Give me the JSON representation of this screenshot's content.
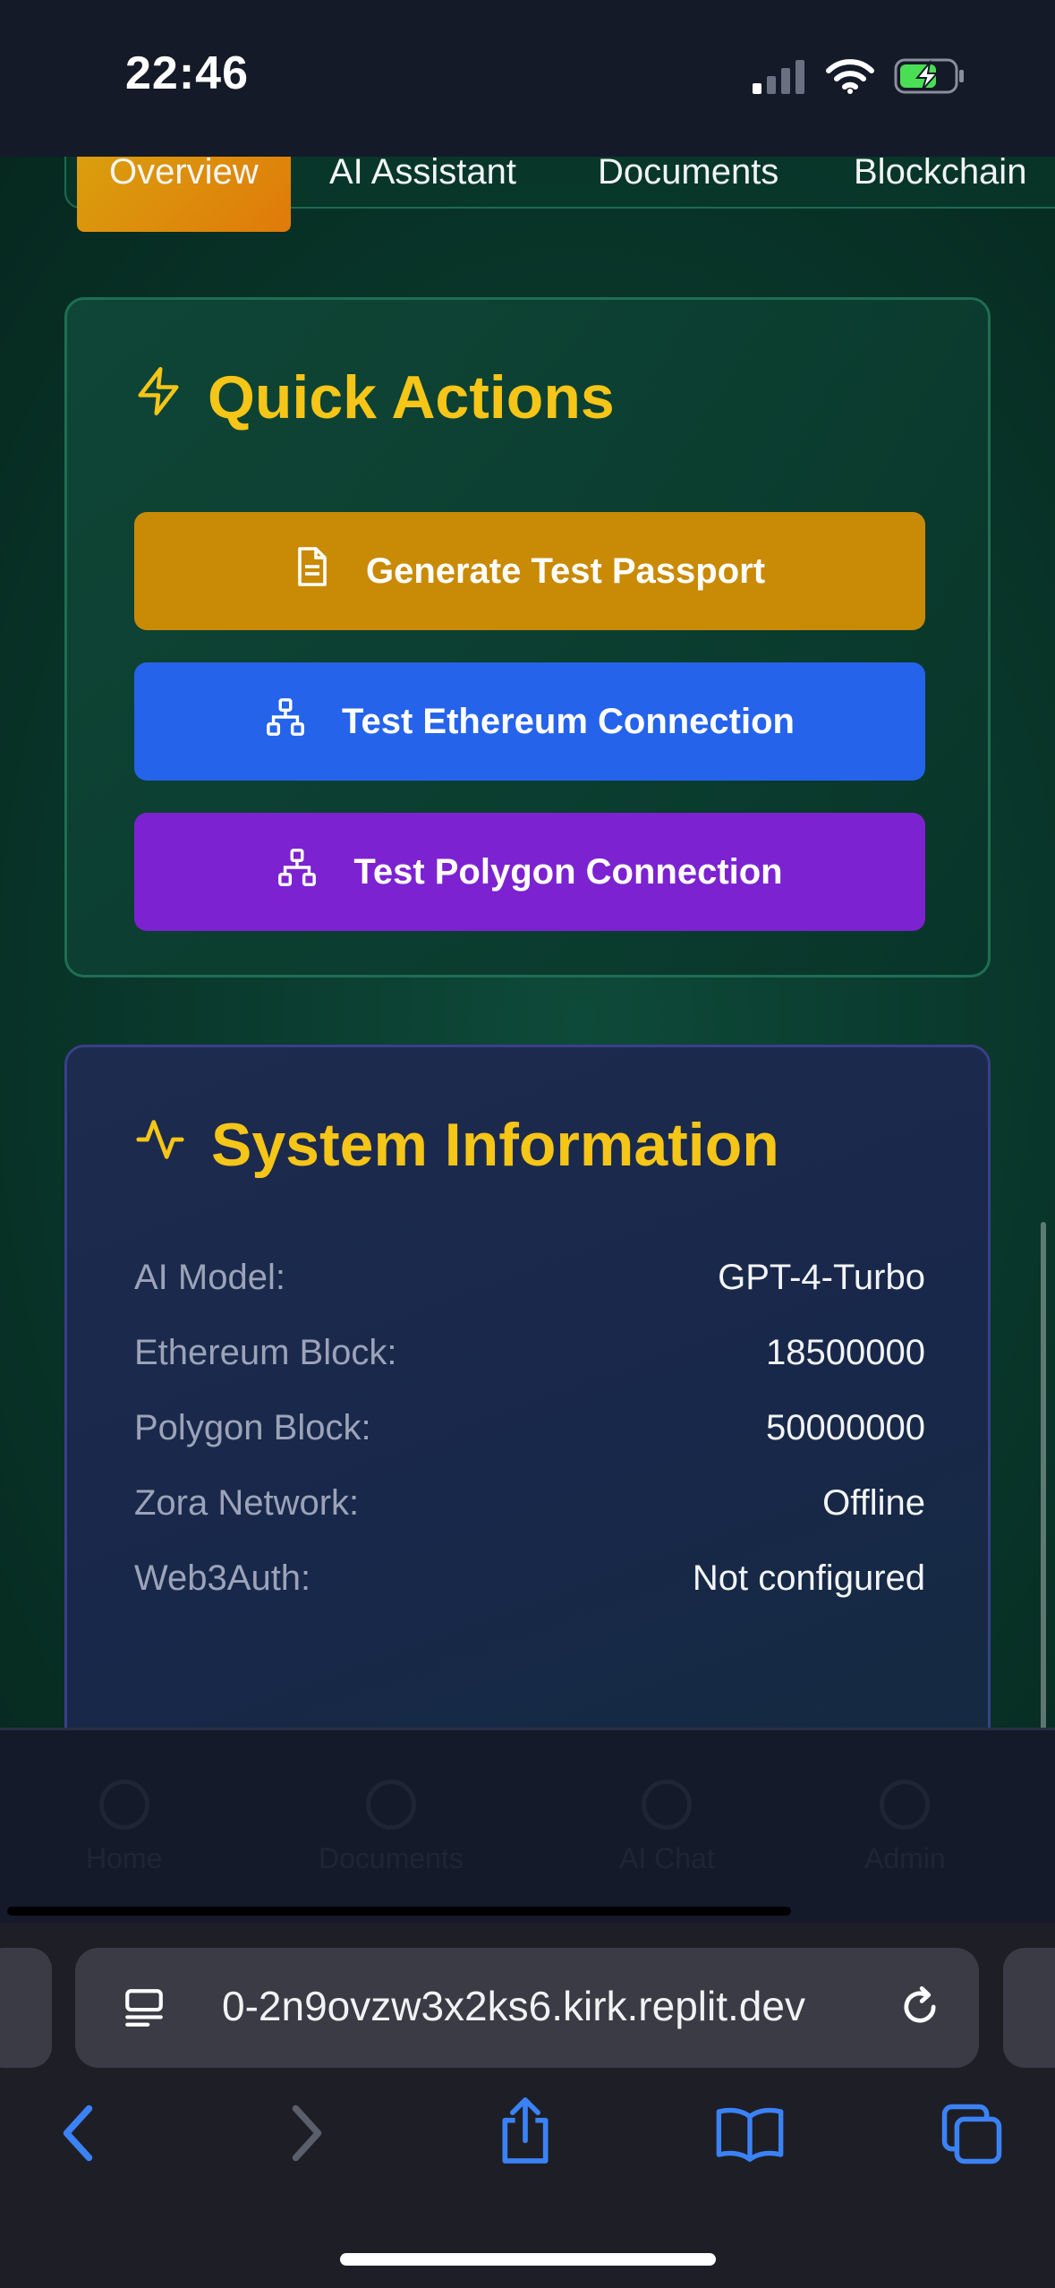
{
  "status_bar": {
    "time": "22:46"
  },
  "tabs": [
    {
      "label": "Overview",
      "active": true
    },
    {
      "label": "AI Assistant",
      "active": false
    },
    {
      "label": "Documents",
      "active": false
    },
    {
      "label": "Blockchain",
      "active": false
    }
  ],
  "quick_actions": {
    "title": "Quick Actions",
    "buttons": [
      {
        "label": "Generate Test Passport",
        "icon": "document-icon",
        "color": "#c98a06"
      },
      {
        "label": "Test Ethereum Connection",
        "icon": "network-icon",
        "color": "#2563eb"
      },
      {
        "label": "Test Polygon Connection",
        "icon": "network-icon",
        "color": "#7c22d1"
      }
    ]
  },
  "system_info": {
    "title": "System Information",
    "rows": [
      {
        "label": "AI Model:",
        "value": "GPT-4-Turbo"
      },
      {
        "label": "Ethereum Block:",
        "value": "18500000"
      },
      {
        "label": "Polygon Block:",
        "value": "50000000"
      },
      {
        "label": "Zora Network:",
        "value": "Offline"
      },
      {
        "label": "Web3Auth:",
        "value": "Not configured"
      }
    ]
  },
  "app_nav": {
    "items": [
      "Home",
      "Documents",
      "AI Chat",
      "Admin"
    ]
  },
  "browser": {
    "url": "0-2n9ovzw3x2ks6.kirk.replit.dev"
  },
  "colors": {
    "accent": "#f5c518",
    "tab_active": "#e07a0a",
    "safari_blue": "#3b82f6"
  }
}
